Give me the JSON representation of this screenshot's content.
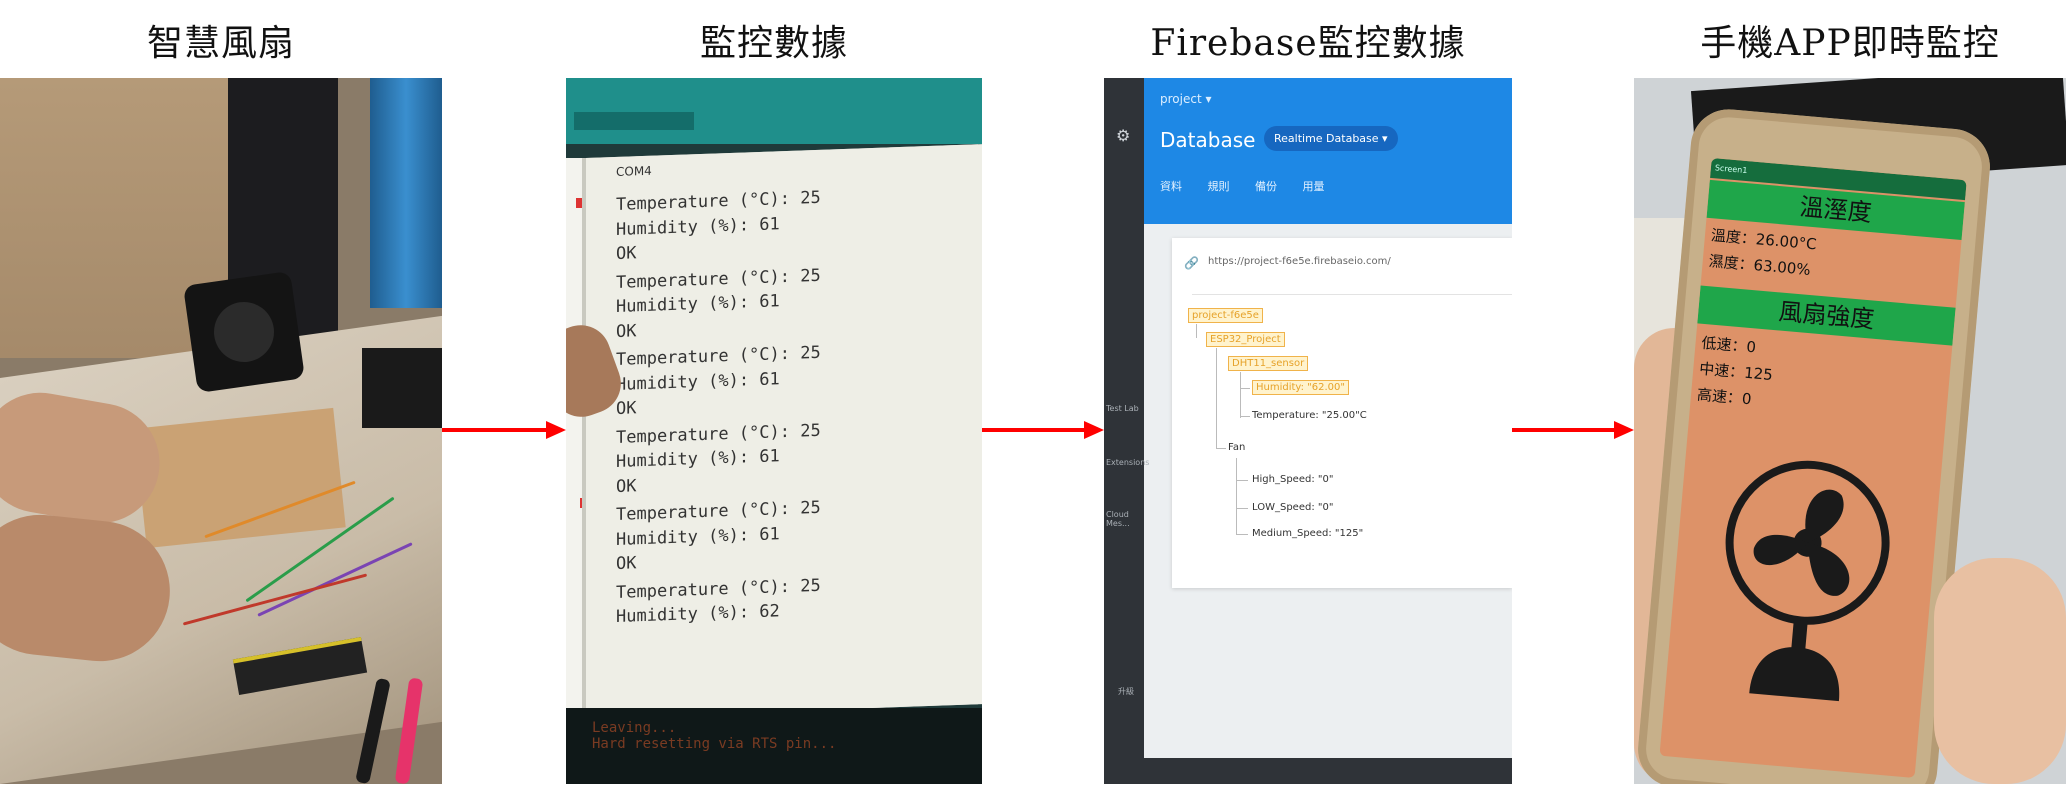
{
  "titles": {
    "p1": "智慧風扇",
    "p2": "監控數據",
    "p3": "Firebase監控數據",
    "p4": "手機APP即時監控"
  },
  "serial": {
    "window_title": "COM4",
    "lines": [
      "Temperature (°C): 25",
      "Humidity (%): 61",
      "OK",
      "Temperature (°C): 25",
      "Humidity (%): 61",
      "OK",
      "Temperature (°C): 25",
      "Humidity (%): 61",
      "OK",
      "Temperature (°C): 25",
      "Humidity (%): 61",
      "OK",
      "Temperature (°C): 25",
      "Humidity (%): 61",
      "OK",
      "Temperature (°C): 25",
      "Humidity (%): 62"
    ],
    "bottom_text": "Leaving...\nHard resetting via RTS pin..."
  },
  "firebase": {
    "project_label": "project ▾",
    "title": "Database",
    "db_selector": "Realtime Database ▾",
    "tabs": [
      "資料",
      "規則",
      "備份",
      "用量"
    ],
    "url": "https://project-f6e5e.firebaseio.com/",
    "side_labels": [
      "Test Lab",
      "Extensions",
      "Cloud Mes...",
      "升級"
    ],
    "tree": {
      "root": "project-f6e5e",
      "project": "ESP32_Project",
      "sensor": "DHT11_sensor",
      "humidity": "Humidity: \"62.00\"",
      "temperature": "Temperature: \"25.00\"C",
      "fan": "Fan",
      "high": "High_Speed: \"0\"",
      "low": "LOW_Speed: \"0\"",
      "medium": "Medium_Speed: \"125\""
    }
  },
  "app": {
    "status_bar": "Screen1",
    "header1": "溫溼度",
    "temp": "溫度：26.00°C",
    "humid": "濕度：63.00%",
    "header2": "風扇強度",
    "low": "低速：0",
    "mid": "中速：125",
    "high": "高速：0"
  },
  "colors": {
    "arrow": "#ff0000",
    "firebase_blue": "#1e88e5",
    "app_green": "#1fa64a",
    "app_bg": "#dd9268",
    "highlight": "#e6a22a"
  }
}
